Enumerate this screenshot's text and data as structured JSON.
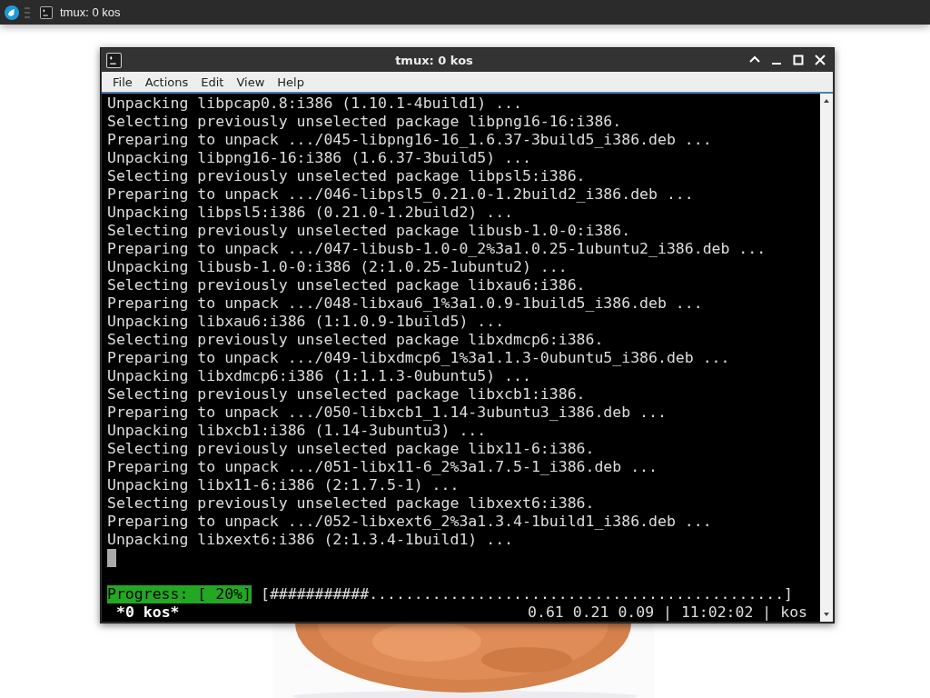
{
  "taskbar": {
    "task": {
      "title": "tmux: 0 kos"
    }
  },
  "window": {
    "title": "tmux: 0 kos"
  },
  "menu": [
    "File",
    "Actions",
    "Edit",
    "View",
    "Help"
  ],
  "terminal": {
    "lines": [
      "Unpacking libpcap0.8:i386 (1.10.1-4build1) ...",
      "Selecting previously unselected package libpng16-16:i386.",
      "Preparing to unpack .../045-libpng16-16_1.6.37-3build5_i386.deb ...",
      "Unpacking libpng16-16:i386 (1.6.37-3build5) ...",
      "Selecting previously unselected package libpsl5:i386.",
      "Preparing to unpack .../046-libpsl5_0.21.0-1.2build2_i386.deb ...",
      "Unpacking libpsl5:i386 (0.21.0-1.2build2) ...",
      "Selecting previously unselected package libusb-1.0-0:i386.",
      "Preparing to unpack .../047-libusb-1.0-0_2%3a1.0.25-1ubuntu2_i386.deb ...",
      "Unpacking libusb-1.0-0:i386 (2:1.0.25-1ubuntu2) ...",
      "Selecting previously unselected package libxau6:i386.",
      "Preparing to unpack .../048-libxau6_1%3a1.0.9-1build5_i386.deb ...",
      "Unpacking libxau6:i386 (1:1.0.9-1build5) ...",
      "Selecting previously unselected package libxdmcp6:i386.",
      "Preparing to unpack .../049-libxdmcp6_1%3a1.1.3-0ubuntu5_i386.deb ...",
      "Unpacking libxdmcp6:i386 (1:1.1.3-0ubuntu5) ...",
      "Selecting previously unselected package libxcb1:i386.",
      "Preparing to unpack .../050-libxcb1_1.14-3ubuntu3_i386.deb ...",
      "Unpacking libxcb1:i386 (1.14-3ubuntu3) ...",
      "Selecting previously unselected package libx11-6:i386.",
      "Preparing to unpack .../051-libx11-6_2%3a1.7.5-1_i386.deb ...",
      "Unpacking libx11-6:i386 (2:1.7.5-1) ...",
      "Selecting previously unselected package libxext6:i386.",
      "Preparing to unpack .../052-libxext6_2%3a1.3.4-1build1_i386.deb ...",
      "Unpacking libxext6:i386 (2:1.3.4-1build1) ..."
    ],
    "progress": {
      "label": "Progress: [ 20%]",
      "bar": "[###########..............................................]"
    },
    "status": {
      "window_name": "*0 kos*",
      "info": "0.61 0.21 0.09 | 11:02:02 | kos"
    }
  }
}
